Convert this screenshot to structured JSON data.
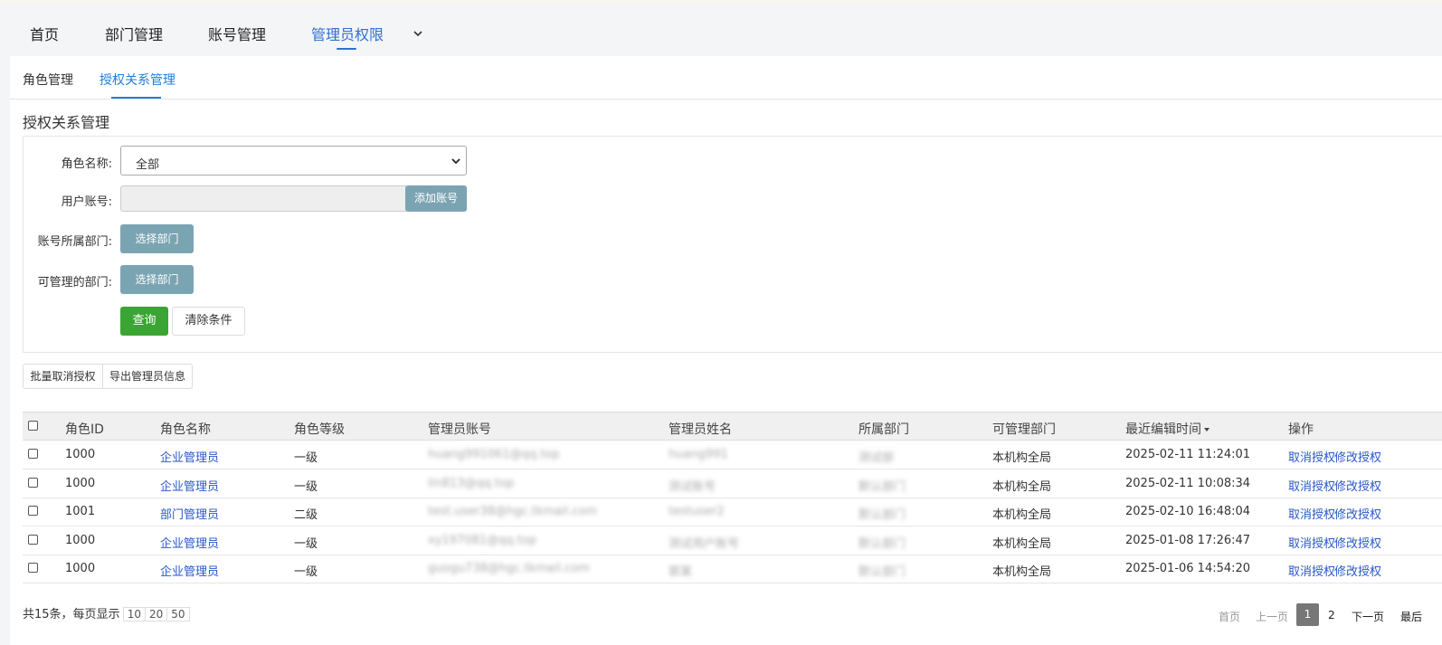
{
  "nav": {
    "items": [
      "首页",
      "部门管理",
      "账号管理",
      "管理员权限"
    ],
    "active_index": 3
  },
  "subtabs": [
    "角色管理",
    "授权关系管理"
  ],
  "page_title": "授权关系管理",
  "filters": {
    "role_label": "角色名称:",
    "role_value": "全部",
    "account_label": "用户账号:",
    "add_account_btn": "添加账号",
    "dept_label": "账号所属部门:",
    "dept_btn": "选择部门",
    "manageable_label": "可管理的部门:",
    "manageable_btn": "选择部门",
    "query_btn": "查询",
    "clear_btn": "清除条件"
  },
  "actions": {
    "batch_revoke": "批量取消授权",
    "export": "导出管理员信息"
  },
  "table": {
    "columns": [
      "角色ID",
      "角色名称",
      "角色等级",
      "管理员账号",
      "管理员姓名",
      "所属部门",
      "可管理部门",
      "最近编辑时间",
      "操作"
    ],
    "revoke_label": "取消授权",
    "edit_label": "修改授权",
    "rows": [
      {
        "id": "1000",
        "role": "企业管理员",
        "level": "一级",
        "account": "huang991061@qq.top",
        "name": "huang991",
        "dept": "测试部",
        "scope": "本机构全局",
        "time": "2025-02-11 11:24:01"
      },
      {
        "id": "1000",
        "role": "企业管理员",
        "level": "一级",
        "account": "lin813@qq.top",
        "name": "测试账号",
        "dept": "默认部门",
        "scope": "本机构全局",
        "time": "2025-02-11 10:08:34"
      },
      {
        "id": "1001",
        "role": "部门管理员",
        "level": "二级",
        "account": "test.user38@hgc.tkmail.com",
        "name": "testuser2",
        "dept": "默认部门",
        "scope": "本机构全局",
        "time": "2025-02-10 16:48:04"
      },
      {
        "id": "1000",
        "role": "企业管理员",
        "level": "一级",
        "account": "xy197081@qq.top",
        "name": "测试用户账号",
        "dept": "默认部门",
        "scope": "本机构全局",
        "time": "2025-01-08 17:26:47"
      },
      {
        "id": "1000",
        "role": "企业管理员",
        "level": "一级",
        "account": "guogu738@hgc.tkmail.com",
        "name": "郭某",
        "dept": "默认部门",
        "scope": "本机构全局",
        "time": "2025-01-06 14:54:20"
      }
    ]
  },
  "footer": {
    "summary": "共15条，每页显示",
    "sizes": [
      "10",
      "20",
      "50"
    ],
    "first": "首页",
    "prev": "上一页",
    "current": "1",
    "page2": "2",
    "next": "下一页",
    "last": "最后"
  }
}
